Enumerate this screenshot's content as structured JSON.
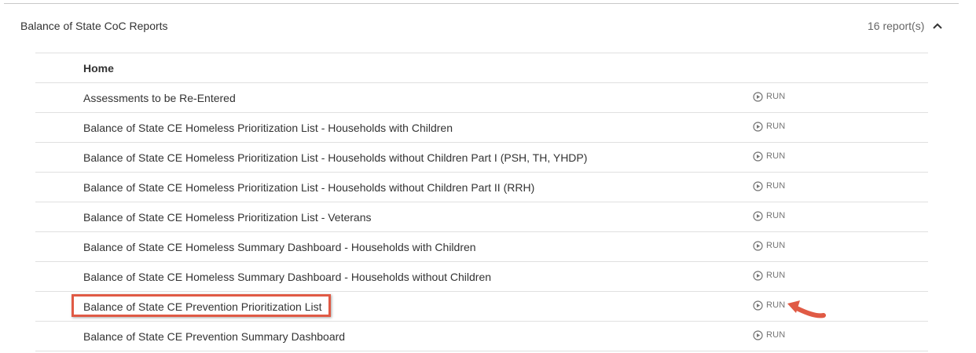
{
  "section": {
    "title": "Balance of State CoC Reports",
    "count": "16 report(s)"
  },
  "group": {
    "label": "Home"
  },
  "reports": [
    {
      "name": "Assessments to be Re-Entered",
      "run": "RUN"
    },
    {
      "name": "Balance of State CE Homeless Prioritization List - Households with Children",
      "run": "RUN"
    },
    {
      "name": "Balance of State CE Homeless Prioritization List - Households without Children Part I (PSH, TH, YHDP)",
      "run": "RUN"
    },
    {
      "name": "Balance of State CE Homeless Prioritization List - Households without Children Part II (RRH)",
      "run": "RUN"
    },
    {
      "name": "Balance of State CE Homeless Prioritization List - Veterans",
      "run": "RUN"
    },
    {
      "name": "Balance of State CE Homeless Summary Dashboard - Households with Children",
      "run": "RUN"
    },
    {
      "name": "Balance of State CE Homeless Summary Dashboard - Households without Children",
      "run": "RUN"
    },
    {
      "name": "Balance of State CE Prevention Prioritization List",
      "run": "RUN"
    },
    {
      "name": "Balance of State CE Prevention Summary Dashboard",
      "run": "RUN"
    }
  ],
  "icons": {
    "collapse": "chevron-up-icon",
    "run": "play-circle-icon"
  },
  "colors": {
    "annotation": "#e05a45",
    "run_text": "#757575"
  }
}
